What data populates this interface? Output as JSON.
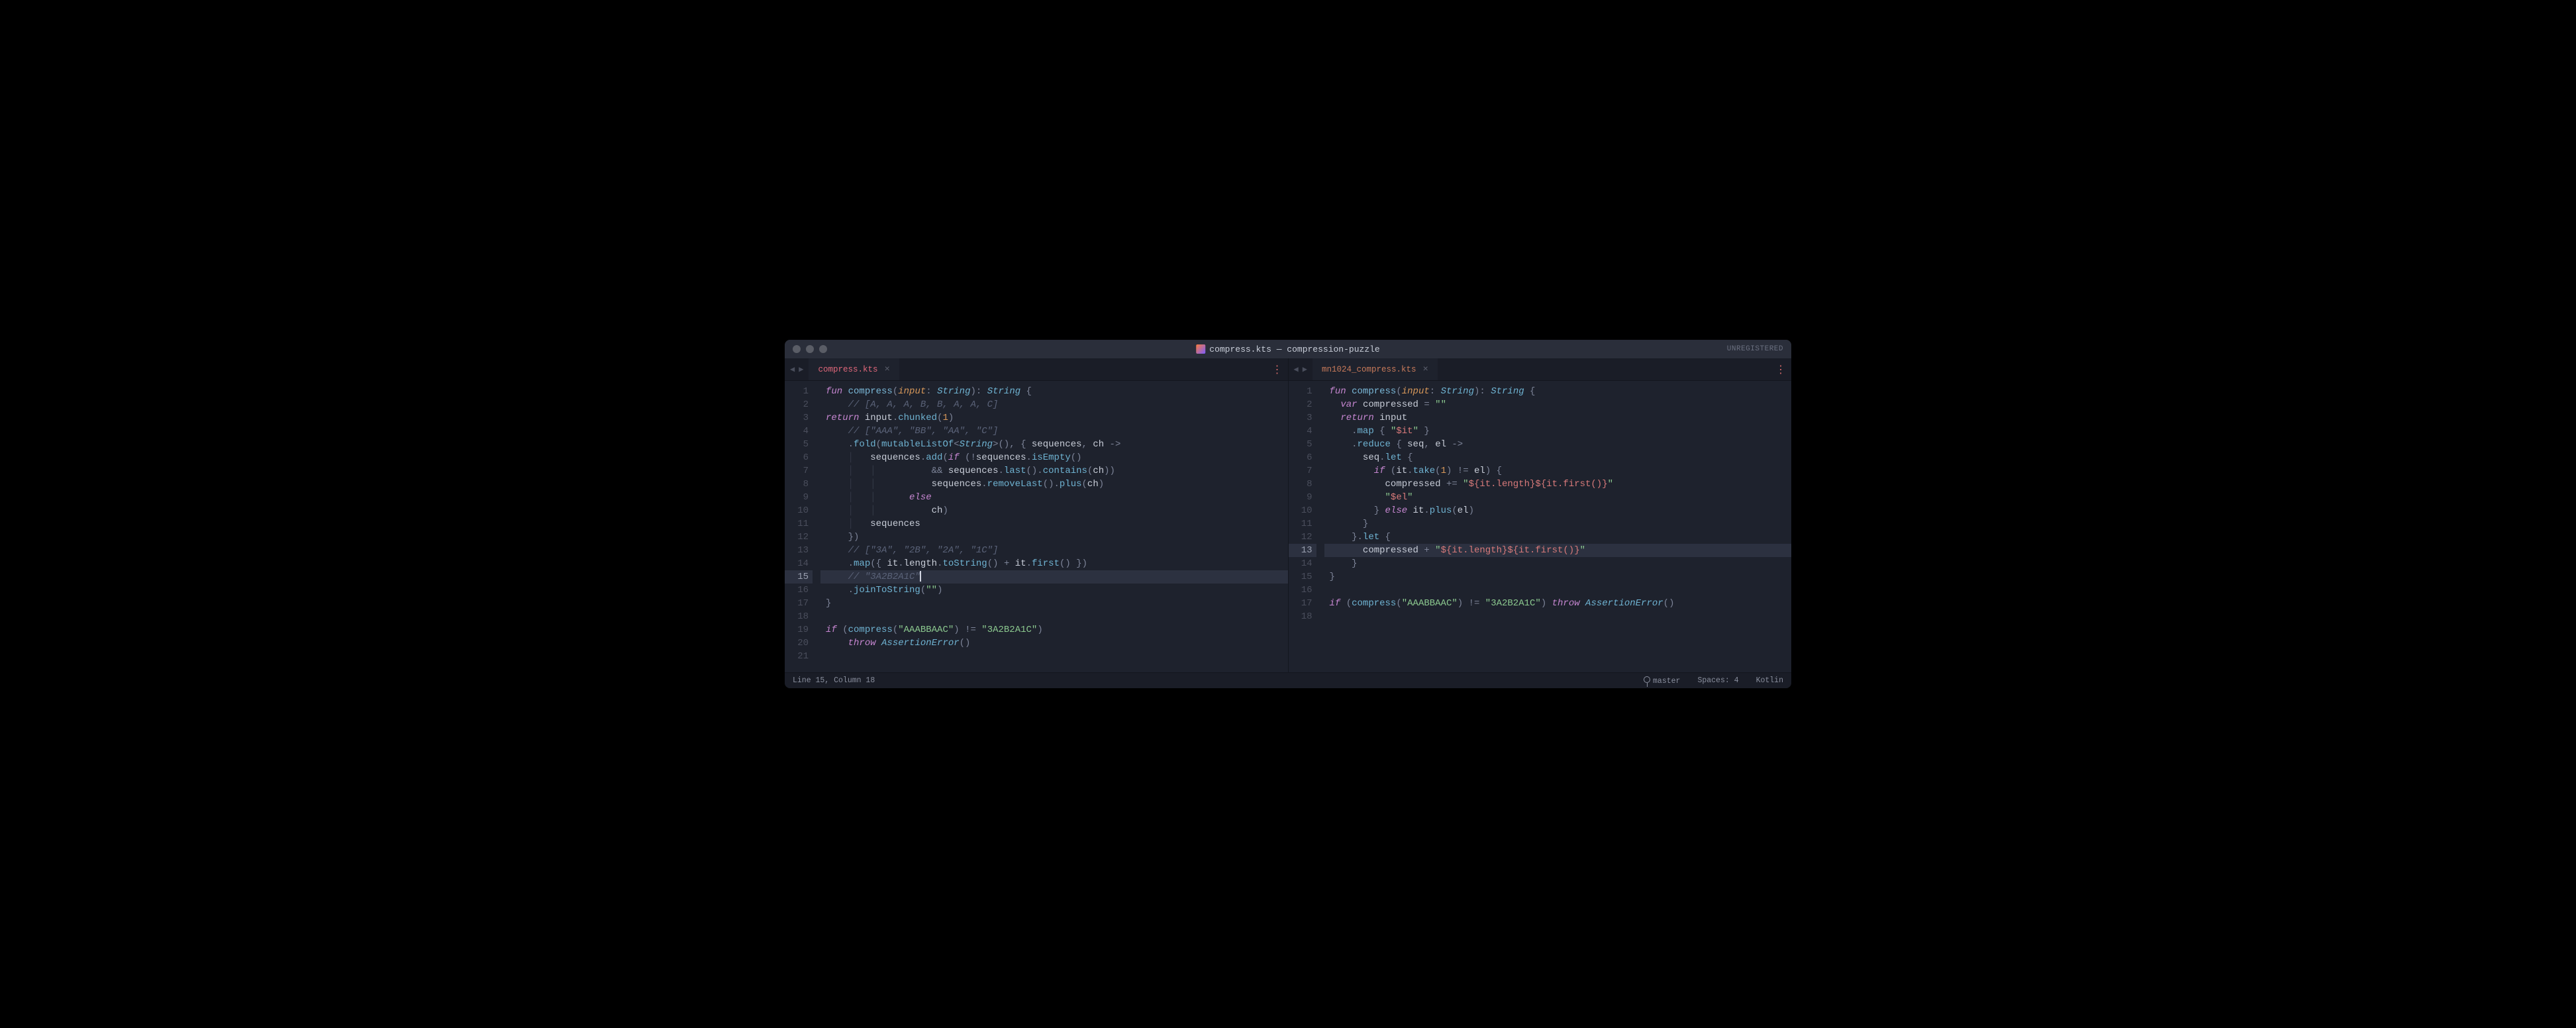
{
  "window": {
    "title_file": "compress.kts",
    "title_project": "compression-puzzle",
    "unregistered": "UNREGISTERED"
  },
  "left": {
    "tab": "compress.kts",
    "active_line": 15,
    "code": [
      [
        {
          "t": "kw",
          "v": "fun"
        },
        {
          "t": "punc",
          "v": " "
        },
        {
          "t": "fnname",
          "v": "compress"
        },
        {
          "t": "punc",
          "v": "("
        },
        {
          "t": "param",
          "v": "input"
        },
        {
          "t": "punc",
          "v": ": "
        },
        {
          "t": "type",
          "v": "String"
        },
        {
          "t": "punc",
          "v": "): "
        },
        {
          "t": "type",
          "v": "String"
        },
        {
          "t": "punc",
          "v": " {"
        }
      ],
      [
        {
          "t": "punc",
          "v": "    "
        },
        {
          "t": "cmt",
          "v": "// [A, A, A, B, B, A, A, C]"
        }
      ],
      [
        {
          "t": "kw",
          "v": "return"
        },
        {
          "t": "punc",
          "v": " "
        },
        {
          "t": "ident",
          "v": "input"
        },
        {
          "t": "punc",
          "v": "."
        },
        {
          "t": "call",
          "v": "chunked"
        },
        {
          "t": "punc",
          "v": "("
        },
        {
          "t": "num",
          "v": "1"
        },
        {
          "t": "punc",
          "v": ")"
        }
      ],
      [
        {
          "t": "guide",
          "v": "    "
        },
        {
          "t": "cmt",
          "v": "// [\"AAA\", \"BB\", \"AA\", \"C\"]"
        }
      ],
      [
        {
          "t": "guide",
          "v": "    "
        },
        {
          "t": "punc",
          "v": "."
        },
        {
          "t": "call",
          "v": "fold"
        },
        {
          "t": "punc",
          "v": "("
        },
        {
          "t": "call",
          "v": "mutableListOf"
        },
        {
          "t": "punc",
          "v": "<"
        },
        {
          "t": "type",
          "v": "String"
        },
        {
          "t": "punc",
          "v": ">(), { "
        },
        {
          "t": "ident",
          "v": "sequences"
        },
        {
          "t": "punc",
          "v": ", "
        },
        {
          "t": "ident",
          "v": "ch"
        },
        {
          "t": "punc",
          "v": " "
        },
        {
          "t": "op",
          "v": "->"
        }
      ],
      [
        {
          "t": "guide",
          "v": "    │   "
        },
        {
          "t": "ident",
          "v": "sequences"
        },
        {
          "t": "punc",
          "v": "."
        },
        {
          "t": "call",
          "v": "add"
        },
        {
          "t": "punc",
          "v": "("
        },
        {
          "t": "kw",
          "v": "if"
        },
        {
          "t": "punc",
          "v": " (!"
        },
        {
          "t": "ident",
          "v": "sequences"
        },
        {
          "t": "punc",
          "v": "."
        },
        {
          "t": "call",
          "v": "isEmpty"
        },
        {
          "t": "punc",
          "v": "()"
        }
      ],
      [
        {
          "t": "guide",
          "v": "    │   │          "
        },
        {
          "t": "op",
          "v": "&&"
        },
        {
          "t": "punc",
          "v": " "
        },
        {
          "t": "ident",
          "v": "sequences"
        },
        {
          "t": "punc",
          "v": "."
        },
        {
          "t": "call",
          "v": "last"
        },
        {
          "t": "punc",
          "v": "()."
        },
        {
          "t": "call",
          "v": "contains"
        },
        {
          "t": "punc",
          "v": "("
        },
        {
          "t": "ident",
          "v": "ch"
        },
        {
          "t": "punc",
          "v": "))"
        }
      ],
      [
        {
          "t": "guide",
          "v": "    │   │          "
        },
        {
          "t": "ident",
          "v": "sequences"
        },
        {
          "t": "punc",
          "v": "."
        },
        {
          "t": "call",
          "v": "removeLast"
        },
        {
          "t": "punc",
          "v": "()."
        },
        {
          "t": "call",
          "v": "plus"
        },
        {
          "t": "punc",
          "v": "("
        },
        {
          "t": "ident",
          "v": "ch"
        },
        {
          "t": "punc",
          "v": ")"
        }
      ],
      [
        {
          "t": "guide",
          "v": "    │   │      "
        },
        {
          "t": "kw",
          "v": "else"
        }
      ],
      [
        {
          "t": "guide",
          "v": "    │   │          "
        },
        {
          "t": "ident",
          "v": "ch"
        },
        {
          "t": "punc",
          "v": ")"
        }
      ],
      [
        {
          "t": "guide",
          "v": "    │   "
        },
        {
          "t": "ident",
          "v": "sequences"
        }
      ],
      [
        {
          "t": "guide",
          "v": "    "
        },
        {
          "t": "punc",
          "v": "})"
        }
      ],
      [
        {
          "t": "guide",
          "v": "    "
        },
        {
          "t": "cmt",
          "v": "// [\"3A\", \"2B\", \"2A\", \"1C\"]"
        }
      ],
      [
        {
          "t": "guide",
          "v": "    "
        },
        {
          "t": "punc",
          "v": "."
        },
        {
          "t": "call",
          "v": "map"
        },
        {
          "t": "punc",
          "v": "({ "
        },
        {
          "t": "ident",
          "v": "it"
        },
        {
          "t": "punc",
          "v": "."
        },
        {
          "t": "ident",
          "v": "length"
        },
        {
          "t": "punc",
          "v": "."
        },
        {
          "t": "call",
          "v": "toString"
        },
        {
          "t": "punc",
          "v": "() "
        },
        {
          "t": "op",
          "v": "+"
        },
        {
          "t": "punc",
          "v": " "
        },
        {
          "t": "ident",
          "v": "it"
        },
        {
          "t": "punc",
          "v": "."
        },
        {
          "t": "call",
          "v": "first"
        },
        {
          "t": "punc",
          "v": "() })"
        }
      ],
      [
        {
          "t": "guide",
          "v": "    "
        },
        {
          "t": "cmt",
          "v": "// \"3A2B2A1C\""
        }
      ],
      [
        {
          "t": "guide",
          "v": "    "
        },
        {
          "t": "punc",
          "v": "."
        },
        {
          "t": "call",
          "v": "joinToString"
        },
        {
          "t": "punc",
          "v": "("
        },
        {
          "t": "str",
          "v": "\"\""
        },
        {
          "t": "punc",
          "v": ")"
        }
      ],
      [
        {
          "t": "punc",
          "v": "}"
        }
      ],
      [],
      [
        {
          "t": "kw",
          "v": "if"
        },
        {
          "t": "punc",
          "v": " ("
        },
        {
          "t": "call",
          "v": "compress"
        },
        {
          "t": "punc",
          "v": "("
        },
        {
          "t": "str",
          "v": "\"AAABBAAC\""
        },
        {
          "t": "punc",
          "v": ") "
        },
        {
          "t": "op",
          "v": "!="
        },
        {
          "t": "punc",
          "v": " "
        },
        {
          "t": "str",
          "v": "\"3A2B2A1C\""
        },
        {
          "t": "punc",
          "v": ")"
        }
      ],
      [
        {
          "t": "guide",
          "v": "    "
        },
        {
          "t": "kw",
          "v": "throw"
        },
        {
          "t": "punc",
          "v": " "
        },
        {
          "t": "type",
          "v": "AssertionError"
        },
        {
          "t": "punc",
          "v": "()"
        }
      ],
      []
    ]
  },
  "right": {
    "tab": "mn1024_compress.kts",
    "active_line": 13,
    "code": [
      [
        {
          "t": "kw",
          "v": "fun"
        },
        {
          "t": "punc",
          "v": " "
        },
        {
          "t": "fnname",
          "v": "compress"
        },
        {
          "t": "punc",
          "v": "("
        },
        {
          "t": "param",
          "v": "input"
        },
        {
          "t": "punc",
          "v": ": "
        },
        {
          "t": "type",
          "v": "String"
        },
        {
          "t": "punc",
          "v": "): "
        },
        {
          "t": "type",
          "v": "String"
        },
        {
          "t": "punc",
          "v": " {"
        }
      ],
      [
        {
          "t": "guide",
          "v": "  "
        },
        {
          "t": "kw",
          "v": "var"
        },
        {
          "t": "punc",
          "v": " "
        },
        {
          "t": "ident",
          "v": "compressed"
        },
        {
          "t": "punc",
          "v": " "
        },
        {
          "t": "op",
          "v": "="
        },
        {
          "t": "punc",
          "v": " "
        },
        {
          "t": "str",
          "v": "\"\""
        }
      ],
      [
        {
          "t": "guide",
          "v": "  "
        },
        {
          "t": "kw",
          "v": "return"
        },
        {
          "t": "punc",
          "v": " "
        },
        {
          "t": "ident",
          "v": "input"
        }
      ],
      [
        {
          "t": "guide",
          "v": "    "
        },
        {
          "t": "punc",
          "v": "."
        },
        {
          "t": "call",
          "v": "map"
        },
        {
          "t": "punc",
          "v": " { "
        },
        {
          "t": "str",
          "v": "\""
        },
        {
          "t": "strtpl",
          "v": "$it"
        },
        {
          "t": "str",
          "v": "\""
        },
        {
          "t": "punc",
          "v": " }"
        }
      ],
      [
        {
          "t": "guide",
          "v": "    "
        },
        {
          "t": "punc",
          "v": "."
        },
        {
          "t": "call",
          "v": "reduce"
        },
        {
          "t": "punc",
          "v": " { "
        },
        {
          "t": "ident",
          "v": "seq"
        },
        {
          "t": "punc",
          "v": ", "
        },
        {
          "t": "ident",
          "v": "el"
        },
        {
          "t": "punc",
          "v": " "
        },
        {
          "t": "op",
          "v": "->"
        }
      ],
      [
        {
          "t": "guide",
          "v": "      "
        },
        {
          "t": "ident",
          "v": "seq"
        },
        {
          "t": "punc",
          "v": "."
        },
        {
          "t": "call",
          "v": "let"
        },
        {
          "t": "punc",
          "v": " {"
        }
      ],
      [
        {
          "t": "guide",
          "v": "        "
        },
        {
          "t": "kw",
          "v": "if"
        },
        {
          "t": "punc",
          "v": " ("
        },
        {
          "t": "ident",
          "v": "it"
        },
        {
          "t": "punc",
          "v": "."
        },
        {
          "t": "call",
          "v": "take"
        },
        {
          "t": "punc",
          "v": "("
        },
        {
          "t": "num",
          "v": "1"
        },
        {
          "t": "punc",
          "v": ") "
        },
        {
          "t": "op",
          "v": "!="
        },
        {
          "t": "punc",
          "v": " "
        },
        {
          "t": "ident",
          "v": "el"
        },
        {
          "t": "punc",
          "v": ") {"
        }
      ],
      [
        {
          "t": "guide",
          "v": "          "
        },
        {
          "t": "ident",
          "v": "compressed"
        },
        {
          "t": "punc",
          "v": " "
        },
        {
          "t": "op",
          "v": "+="
        },
        {
          "t": "punc",
          "v": " "
        },
        {
          "t": "str",
          "v": "\""
        },
        {
          "t": "strtpl",
          "v": "${it.length}${it.first()}"
        },
        {
          "t": "str",
          "v": "\""
        }
      ],
      [
        {
          "t": "guide",
          "v": "          "
        },
        {
          "t": "str",
          "v": "\""
        },
        {
          "t": "strtpl",
          "v": "$el"
        },
        {
          "t": "str",
          "v": "\""
        }
      ],
      [
        {
          "t": "guide",
          "v": "        "
        },
        {
          "t": "punc",
          "v": "} "
        },
        {
          "t": "kw",
          "v": "else"
        },
        {
          "t": "punc",
          "v": " "
        },
        {
          "t": "ident",
          "v": "it"
        },
        {
          "t": "punc",
          "v": "."
        },
        {
          "t": "call",
          "v": "plus"
        },
        {
          "t": "punc",
          "v": "("
        },
        {
          "t": "ident",
          "v": "el"
        },
        {
          "t": "punc",
          "v": ")"
        }
      ],
      [
        {
          "t": "guide",
          "v": "      "
        },
        {
          "t": "punc",
          "v": "}"
        }
      ],
      [
        {
          "t": "guide",
          "v": "    "
        },
        {
          "t": "punc",
          "v": "}."
        },
        {
          "t": "call",
          "v": "let"
        },
        {
          "t": "punc",
          "v": " {"
        }
      ],
      [
        {
          "t": "guide",
          "v": "      "
        },
        {
          "t": "ident",
          "v": "compressed"
        },
        {
          "t": "punc",
          "v": " "
        },
        {
          "t": "op",
          "v": "+"
        },
        {
          "t": "punc",
          "v": " "
        },
        {
          "t": "str",
          "v": "\""
        },
        {
          "t": "strtpl",
          "v": "${it.length}${it.first()}"
        },
        {
          "t": "str",
          "v": "\""
        }
      ],
      [
        {
          "t": "guide",
          "v": "    "
        },
        {
          "t": "punc",
          "v": "}"
        }
      ],
      [
        {
          "t": "punc",
          "v": "}"
        }
      ],
      [],
      [
        {
          "t": "kw",
          "v": "if"
        },
        {
          "t": "punc",
          "v": " ("
        },
        {
          "t": "call",
          "v": "compress"
        },
        {
          "t": "punc",
          "v": "("
        },
        {
          "t": "str",
          "v": "\"AAABBAAC\""
        },
        {
          "t": "punc",
          "v": ") "
        },
        {
          "t": "op",
          "v": "!="
        },
        {
          "t": "punc",
          "v": " "
        },
        {
          "t": "str",
          "v": "\"3A2B2A1C\""
        },
        {
          "t": "punc",
          "v": ") "
        },
        {
          "t": "kw",
          "v": "throw"
        },
        {
          "t": "punc",
          "v": " "
        },
        {
          "t": "type",
          "v": "AssertionError"
        },
        {
          "t": "punc",
          "v": "()"
        }
      ],
      []
    ]
  },
  "status": {
    "cursor": "Line 15, Column 18",
    "branch": "master",
    "spaces": "Spaces: 4",
    "lang": "Kotlin"
  }
}
